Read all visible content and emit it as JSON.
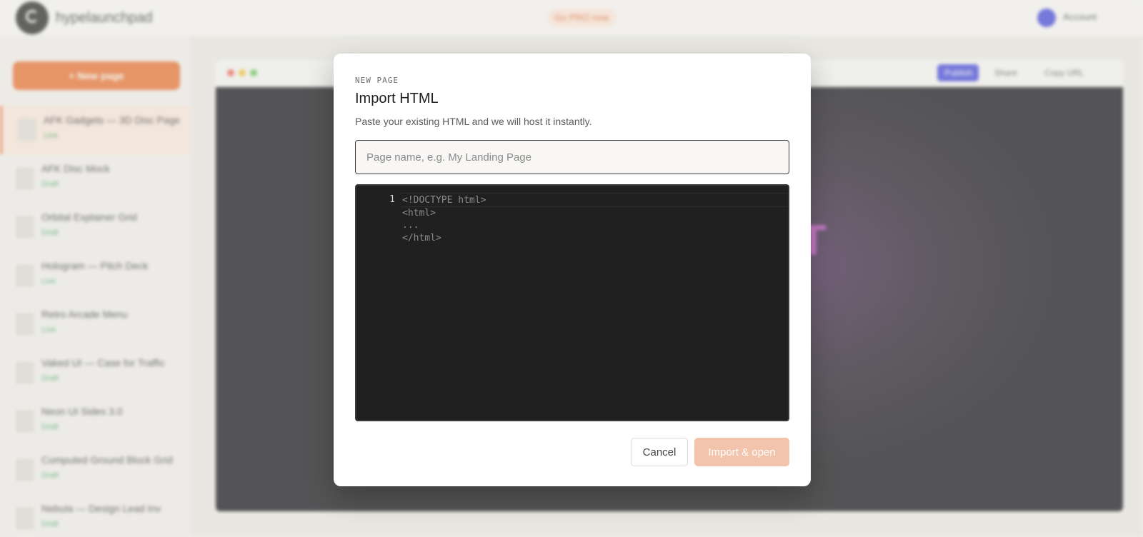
{
  "app": {
    "brand": "hypelaunchpad",
    "promo": "Go PRO now",
    "user_name": "Account",
    "new_page_label": "+ New page"
  },
  "sidebar": {
    "pages": [
      {
        "title": "AFK Gadgets — 3D Disc Page",
        "status": "Live"
      },
      {
        "title": "AFK Disc Mock",
        "status": "Draft"
      },
      {
        "title": "Orbital Explainer Grid",
        "status": "Draft"
      },
      {
        "title": "Hologram — Pitch Deck",
        "status": "Live"
      },
      {
        "title": "Retro Arcade Menu",
        "status": "Live"
      },
      {
        "title": "Vaked UI — Case for Traffic",
        "status": "Draft"
      },
      {
        "title": "Neon UI Sides 3.0",
        "status": "Draft"
      },
      {
        "title": "Computed Ground Block Grid",
        "status": "Draft"
      },
      {
        "title": "Nebula — Design Lead Inv",
        "status": "Draft"
      }
    ]
  },
  "preview_toolbar": {
    "primary": "Publish",
    "share": "Share",
    "copy": "Copy URL"
  },
  "modal": {
    "eyebrow": "NEW PAGE",
    "title": "Import HTML",
    "subtitle": "Paste your existing HTML and we will host it instantly.",
    "name_placeholder": "Page name, e.g. My Landing Page",
    "line_number": "1",
    "code_placeholder": "<!DOCTYPE html>\n<html>\n...\n</html>",
    "cancel_label": "Cancel",
    "import_label": "Import & open"
  },
  "colors": {
    "accent": "#e76a27",
    "import_disabled": "#f1c4ab",
    "editor_bg": "#202020"
  }
}
